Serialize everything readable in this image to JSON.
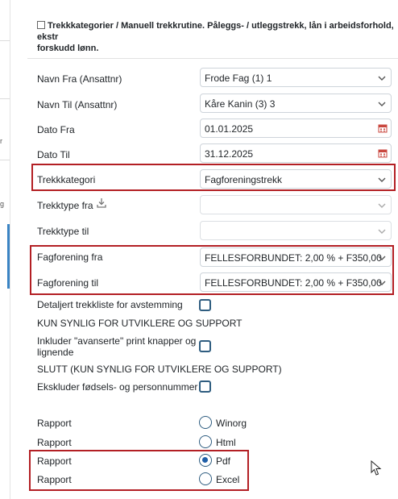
{
  "sidebar": {
    "fragments": [
      "r",
      "g"
    ]
  },
  "header": {
    "line1": "Trekkkategorier / Manuell trekkrutine. Pålеggs- / utleggstrekk, lån i arbeidsforhold, ekstr",
    "line2": "forskudd lønn."
  },
  "form": {
    "navn_fra": {
      "label": "Navn Fra (Ansattnr)",
      "value": "Frode Fag (1) 1"
    },
    "navn_til": {
      "label": "Navn Til (Ansattnr)",
      "value": "Kåre Kanin (3) 3"
    },
    "dato_fra": {
      "label": "Dato Fra",
      "value": "01.01.2025"
    },
    "dato_til": {
      "label": "Dato Til",
      "value": "31.12.2025"
    },
    "trekkkategori": {
      "label": "Trekkkategori",
      "value": "Fagforeningstrekk"
    },
    "trekktype_fra": {
      "label": "Trekktype fra",
      "value": ""
    },
    "trekktype_til": {
      "label": "Trekktype til",
      "value": ""
    },
    "fagforening_fra": {
      "label": "Fagforening fra",
      "value": "FELLESFORBUNDET: 2,00 % + F350,00"
    },
    "fagforening_til": {
      "label": "Fagforening til",
      "value": "FELLESFORBUNDET: 2,00 % + F350,00"
    },
    "detaljert": {
      "label": "Detaljert trekkliste for avstemming",
      "checked": false
    },
    "kun_synlig": "KUN SYNLIG FOR UTVIKLERE OG SUPPORT",
    "avanserte": {
      "label_line1": "Inkluder \"avanserte\" print knapper og",
      "label_line2": "lignende",
      "checked": false
    },
    "slutt": "SLUTT (KUN SYNLIG FOR UTVIKLERE OG SUPPORT)",
    "ekskluder": {
      "label": "Ekskluder fødsels- og personnummer",
      "checked": false
    }
  },
  "rapport": {
    "label": "Rapport",
    "options": [
      {
        "label": "Winorg",
        "selected": false
      },
      {
        "label": "Html",
        "selected": false
      },
      {
        "label": "Pdf",
        "selected": true
      },
      {
        "label": "Excel",
        "selected": false
      }
    ]
  },
  "colors": {
    "highlight": "#b31f24",
    "accent": "#3a84c4",
    "radio_selected": "#1f5fa8"
  }
}
